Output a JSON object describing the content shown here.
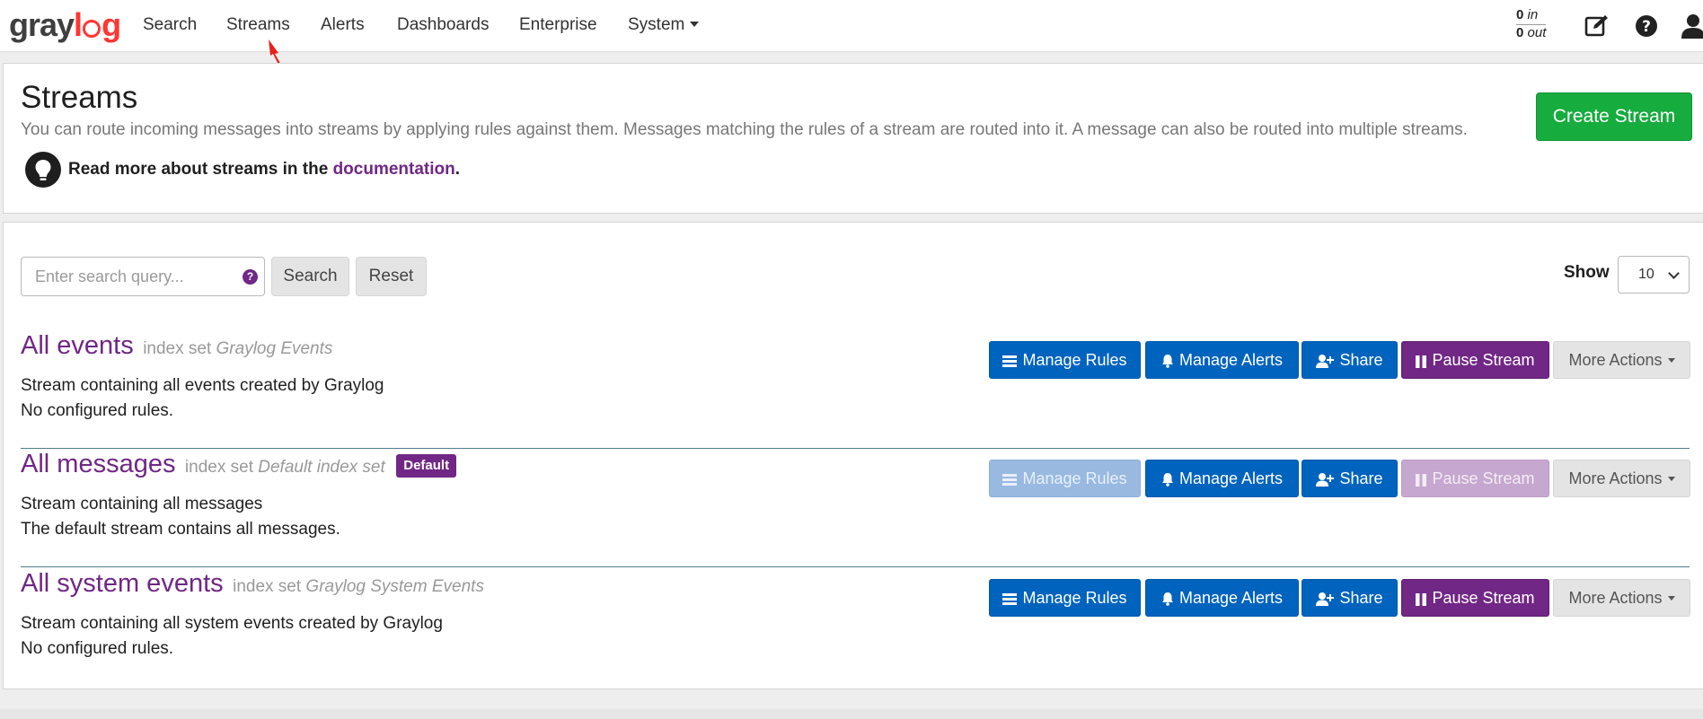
{
  "navbar": {
    "brand": "graylog",
    "items": [
      {
        "label": "Search"
      },
      {
        "label": "Streams"
      },
      {
        "label": "Alerts"
      },
      {
        "label": "Dashboards"
      },
      {
        "label": "Enterprise"
      },
      {
        "label": "System"
      }
    ],
    "throughput": {
      "in_value": "0",
      "in_label": "in",
      "out_value": "0",
      "out_label": "out"
    },
    "icons": [
      "edit-icon",
      "help-icon",
      "user-icon"
    ]
  },
  "header": {
    "title": "Streams",
    "description": "You can route incoming messages into streams by applying rules against them. Messages matching the rules of a stream are routed into it. A message can also be routed into multiple streams.",
    "read_more_prefix": "Read more about streams in the ",
    "read_more_link": "documentation",
    "read_more_suffix": ".",
    "create_button": "Create Stream"
  },
  "toolbar": {
    "search_placeholder": "Enter search query...",
    "search_button": "Search",
    "reset_button": "Reset",
    "show_label": "Show",
    "show_value": "10"
  },
  "actions": {
    "manage_rules": "Manage Rules",
    "manage_alerts": "Manage Alerts",
    "share": "Share",
    "pause_stream": "Pause Stream",
    "more_actions": "More Actions"
  },
  "streams": [
    {
      "name": "All events",
      "index_set_prefix": "index set",
      "index_set_name": "Graylog Events",
      "description": "Stream containing all events created by Graylog",
      "rules": "No configured rules."
    },
    {
      "name": "All messages",
      "index_set_prefix": "index set",
      "index_set_name": "Default index set",
      "badge": "Default",
      "description": "Stream containing all messages",
      "rules": "The default stream contains all messages."
    },
    {
      "name": "All system events",
      "index_set_prefix": "index set",
      "index_set_name": "Graylog System Events",
      "description": "Stream containing all system events created by Graylog",
      "rules": "No configured rules."
    }
  ],
  "colors": {
    "primary_blue": "#0063be",
    "purple": "#702785",
    "green": "#16ac3e",
    "brand_red": "#ff3633"
  }
}
